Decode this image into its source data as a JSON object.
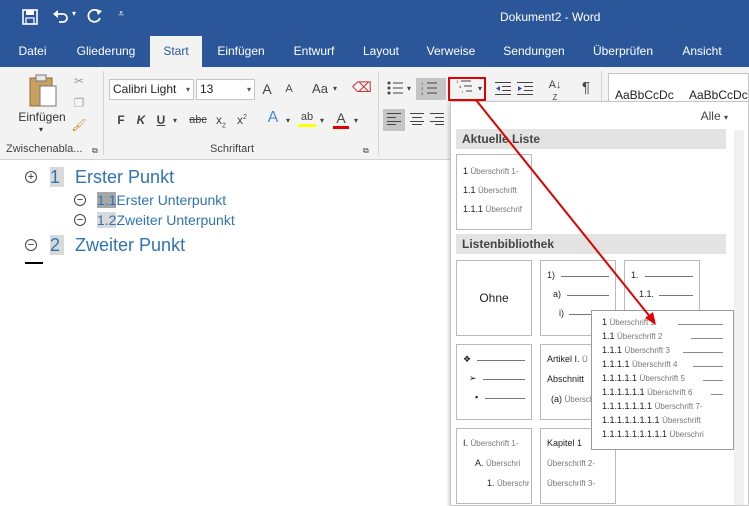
{
  "window": {
    "title": "Dokument2 - Word"
  },
  "quick_access": {
    "save": "save-icon",
    "undo": "undo-icon",
    "redo": "redo-icon",
    "customize": "customize-icon"
  },
  "tabs": [
    {
      "label": "Datei"
    },
    {
      "label": "Gliederung"
    },
    {
      "label": "Start",
      "active": true
    },
    {
      "label": "Einfügen"
    },
    {
      "label": "Entwurf"
    },
    {
      "label": "Layout"
    },
    {
      "label": "Verweise"
    },
    {
      "label": "Sendungen"
    },
    {
      "label": "Überprüfen"
    },
    {
      "label": "Ansicht"
    }
  ],
  "ribbon": {
    "clipboard": {
      "paste_label": "Einfügen",
      "group_label": "Zwischenabla..."
    },
    "font": {
      "font_name": "Calibri Light",
      "font_size": "13",
      "group_label": "Schriftart",
      "grow": "A",
      "shrink": "A",
      "case": "Aa",
      "bold": "F",
      "italic": "K",
      "underline": "U",
      "strike": "abc",
      "sub": "x",
      "sup": "x"
    },
    "paragraph": {
      "pilcrow": "¶"
    },
    "styles": {
      "sample1": "AaBbCcDc",
      "sample2": "AaBbCcDc"
    }
  },
  "document": {
    "items": [
      {
        "num": "1",
        "text": "Erster Punkt"
      },
      {
        "num": "1.1",
        "text": "Erster Unterpunkt"
      },
      {
        "num": "1.2",
        "text": "Zweiter Unterpunkt"
      },
      {
        "num": "2",
        "text": "Zweiter Punkt"
      }
    ]
  },
  "list_gallery": {
    "filter": "Alle",
    "current_header": "Aktuelle Liste",
    "library_header": "Listenbibliothek",
    "none_label": "Ohne",
    "current": [
      {
        "num": "1",
        "text": "Überschrift 1-"
      },
      {
        "num": "1.1",
        "text": "Überschrift"
      },
      {
        "num": "1.1.1",
        "text": "Überschrif"
      }
    ],
    "tile_b": [
      "1)",
      "a)",
      "i)"
    ],
    "tile_c": [
      "1.",
      "1.1."
    ],
    "tile_d": [
      "❖",
      "➢",
      "▪"
    ],
    "tile_e": [
      {
        "num": "Artikel I.",
        "text": "Ü"
      },
      {
        "num": "Abschnitt",
        "text": ""
      },
      {
        "num": "(a)",
        "text": "Überschr"
      }
    ],
    "tile_f": [
      {
        "num": "I.",
        "text": "Überschrift 1-"
      },
      {
        "num": "A.",
        "text": "Überschri"
      },
      {
        "num": "1.",
        "text": "Überschr"
      }
    ],
    "tile_g": [
      {
        "num": "Kapitel 1",
        "text": ""
      },
      {
        "num": "",
        "text": "Überschrift 2-"
      },
      {
        "num": "",
        "text": "Überschrift 3-"
      }
    ]
  },
  "preview": [
    {
      "num": "1",
      "text": "Überschrift 1"
    },
    {
      "num": "1.1",
      "text": "Überschrift 2"
    },
    {
      "num": "1.1.1",
      "text": "Überschrift 3"
    },
    {
      "num": "1.1.1.1",
      "text": "Überschrift 4"
    },
    {
      "num": "1.1.1.1.1",
      "text": "Überschrift 5"
    },
    {
      "num": "1.1.1.1.1.1",
      "text": "Überschrift 6"
    },
    {
      "num": "1.1.1.1.1.1.1",
      "text": "Überschrift 7-"
    },
    {
      "num": "1.1.1.1.1.1.1.1",
      "text": "Überschrift"
    },
    {
      "num": "1.1.1.1.1.1.1.1.1",
      "text": "Überschri"
    }
  ],
  "colors": {
    "accent": "#2b579a",
    "heading": "#2e74b5",
    "highlight_box": "#e00000"
  }
}
